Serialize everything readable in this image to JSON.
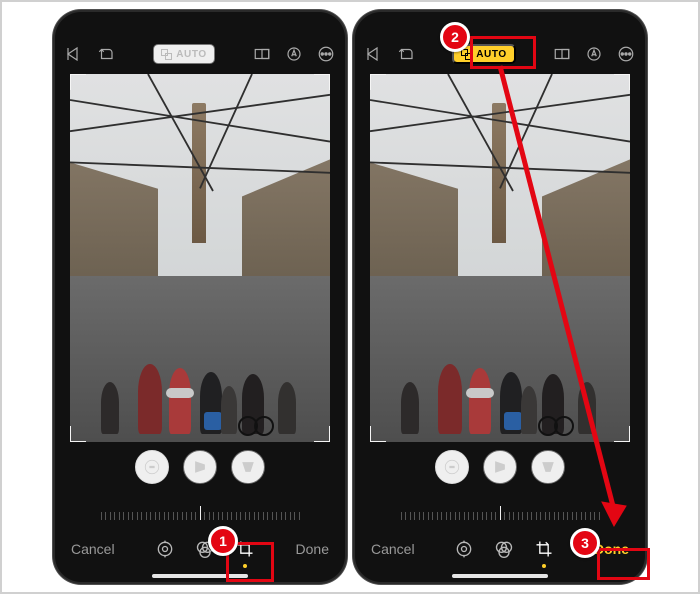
{
  "topbar": {
    "auto_label": "AUTO"
  },
  "mode_circles": {
    "straighten": "straighten-icon",
    "horizontal": "flip-horizontal-icon",
    "vertical": "flip-vertical-icon"
  },
  "bottom": {
    "cancel": "Cancel",
    "done": "Done"
  },
  "annotations": {
    "step1": "1",
    "step2": "2",
    "step3": "3"
  },
  "screens": [
    {
      "auto_state": "off",
      "crop_active": true,
      "done_active": false
    },
    {
      "auto_state": "on",
      "crop_active": true,
      "done_active": true
    }
  ]
}
